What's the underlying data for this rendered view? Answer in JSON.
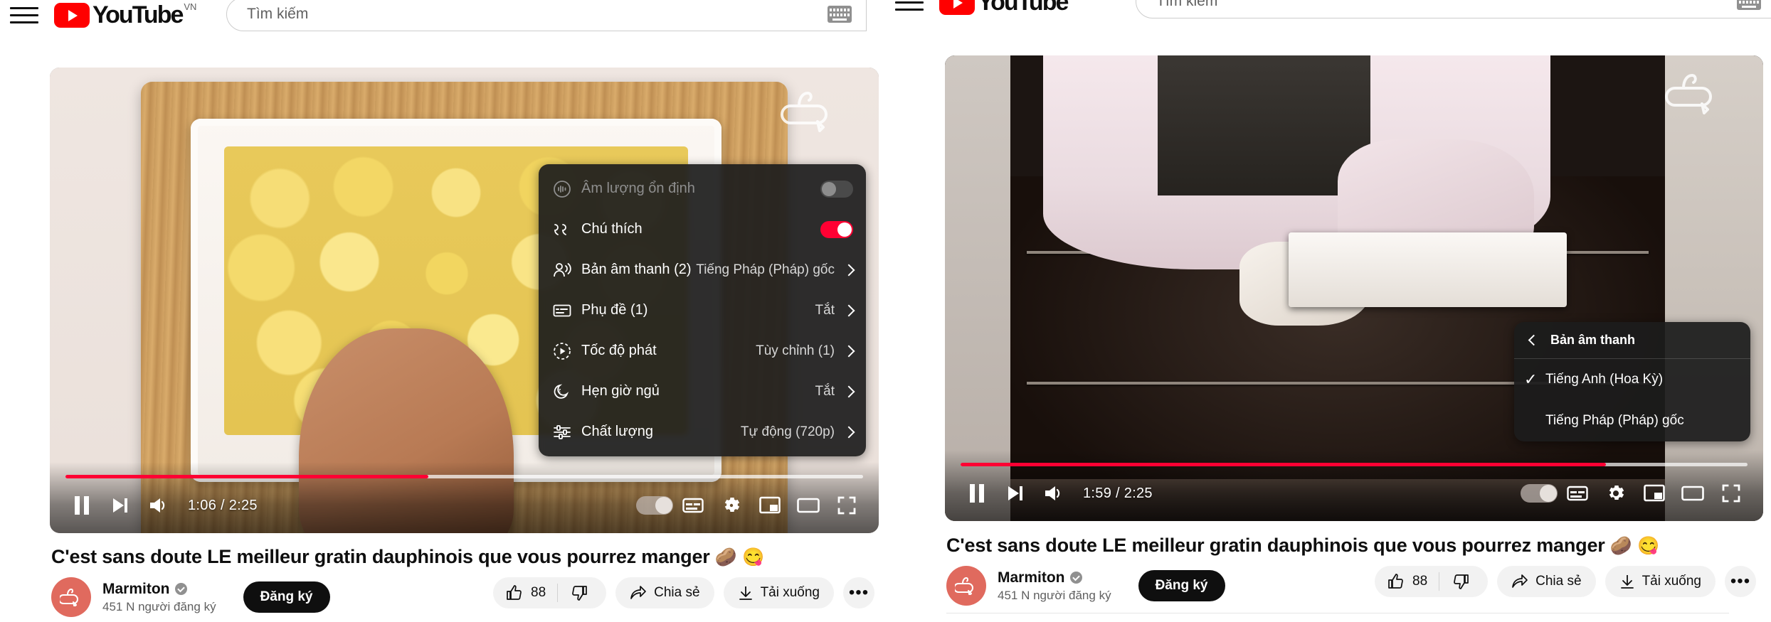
{
  "masthead": {
    "menu_icon": "hamburger-icon",
    "logo_text": "YouTube",
    "logo_country": "VN",
    "search_placeholder": "Tìm kiếm",
    "keyboard_icon": "keyboard-icon"
  },
  "video": {
    "title": "C'est sans doute LE meilleur gratin dauphinois que vous pourrez manger",
    "title_emoji_1": "🥔",
    "title_emoji_2": "😋",
    "channel_name": "Marmiton",
    "channel_subs": "451 N người đăng ký",
    "subscribe_label": "Đăng ký",
    "verified_icon": "verified-badge-icon"
  },
  "actions": {
    "like_count": "88",
    "like_icon": "thumbs-up-icon",
    "dislike_icon": "thumbs-down-icon",
    "share_label": "Chia sẻ",
    "share_icon": "share-arrow-icon",
    "download_label": "Tải xuống",
    "download_icon": "download-arrow-icon",
    "more_label": "•••",
    "more_icon": "more-horizontal-icon"
  },
  "player_left": {
    "current_time": "1:06",
    "total_time": "2:25",
    "time_display": "1:06 / 2:25",
    "progress_percent": 45.5,
    "buffered_percent": 100,
    "pause_icon": "pause-icon",
    "next_icon": "next-track-icon",
    "volume_icon": "volume-high-icon",
    "autoplay_icon": "autoplay-toggle-icon",
    "subtitles_icon": "subtitles-icon",
    "settings_icon": "gear-icon",
    "miniplayer_icon": "miniplayer-icon",
    "theater_icon": "theater-mode-icon",
    "fullscreen_icon": "fullscreen-icon"
  },
  "player_right": {
    "current_time": "1:59",
    "total_time": "2:25",
    "time_display": "1:59 / 2:25",
    "progress_percent": 82,
    "buffered_percent": 100,
    "pause_icon": "pause-icon",
    "next_icon": "next-track-icon",
    "volume_icon": "volume-high-icon",
    "autoplay_icon": "autoplay-toggle-icon",
    "subtitles_icon": "subtitles-icon",
    "settings_icon": "gear-icon",
    "miniplayer_icon": "miniplayer-icon",
    "theater_icon": "theater-mode-icon",
    "fullscreen_icon": "fullscreen-icon"
  },
  "settings_menu": {
    "rows": [
      {
        "label": "Âm lượng ổn định",
        "icon": "stable-volume-icon",
        "control": "toggle",
        "toggle_state": "off",
        "value": "",
        "disabled": true
      },
      {
        "label": "Chú thích",
        "icon": "annotations-icon",
        "control": "toggle",
        "toggle_state": "on",
        "value": "",
        "disabled": false
      },
      {
        "label": "Bản âm thanh (2)",
        "icon": "audio-track-icon",
        "control": "submenu",
        "value": "Tiếng Pháp (Pháp) gốc",
        "disabled": false
      },
      {
        "label": "Phụ đề (1)",
        "icon": "subtitles-icon",
        "control": "submenu",
        "value": "Tắt",
        "disabled": false
      },
      {
        "label": "Tốc độ phát",
        "icon": "playback-speed-icon",
        "control": "submenu",
        "value": "Tùy chỉnh (1)",
        "disabled": false
      },
      {
        "label": "Hẹn giờ ngủ",
        "icon": "sleep-timer-icon",
        "control": "submenu",
        "value": "Tắt",
        "disabled": false
      },
      {
        "label": "Chất lượng",
        "icon": "quality-sliders-icon",
        "control": "submenu",
        "value": "Tự động (720p)",
        "disabled": false
      }
    ]
  },
  "audio_submenu": {
    "header": "Bản âm thanh",
    "back_icon": "chevron-left-icon",
    "items": [
      {
        "label": "Tiếng Anh (Hoa Kỳ)",
        "selected": true,
        "check": "✓"
      },
      {
        "label": "Tiếng Pháp (Pháp) gốc",
        "selected": false,
        "check": ""
      }
    ]
  },
  "colors": {
    "brand_red": "#ff0000",
    "progress_red": "#ff0033",
    "toggle_on": "#ff0033",
    "text_primary": "#0f0f0f",
    "text_secondary": "#606060",
    "pill_bg": "#f2f2f2",
    "menu_bg": "rgba(28,28,28,.92)",
    "avatar_bg": "#e06a5e"
  }
}
